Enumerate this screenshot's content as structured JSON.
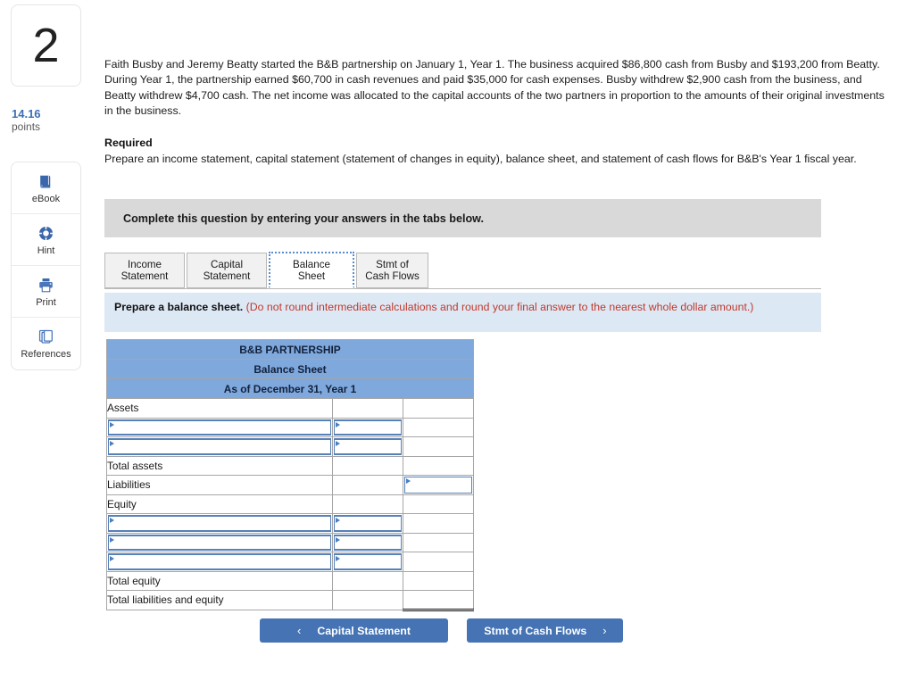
{
  "question": {
    "number": "2",
    "points_value": "14.16",
    "points_label": "points"
  },
  "tools": [
    {
      "label": "eBook",
      "icon": "book-icon"
    },
    {
      "label": "Hint",
      "icon": "lifebuoy-icon"
    },
    {
      "label": "Print",
      "icon": "printer-icon"
    },
    {
      "label": "References",
      "icon": "pages-icon"
    }
  ],
  "problem": {
    "body": "Faith Busby and Jeremy Beatty started the B&B partnership on January 1, Year 1. The business acquired $86,800 cash from Busby and $193,200 from Beatty. During Year 1, the partnership earned $60,700 in cash revenues and paid $35,000 for cash expenses. Busby withdrew $2,900 cash from the business, and Beatty withdrew $4,700 cash. The net income was allocated to the capital accounts of the two partners in proportion to the amounts of their original investments in the business.",
    "required_heading": "Required",
    "required_body": "Prepare an income statement, capital statement (statement of changes in equity), balance sheet, and statement of cash flows for B&B's Year 1 fiscal year."
  },
  "complete_bar": {
    "text": "Complete this question by entering your answers in the tabs below."
  },
  "tabs": [
    {
      "label": "Income Statement",
      "active": false
    },
    {
      "label": "Capital Statement",
      "active": false
    },
    {
      "label": "Balance Sheet",
      "active": true
    },
    {
      "label": "Stmt of Cash Flows",
      "active": false
    }
  ],
  "instruction": {
    "bold": "Prepare a balance sheet.",
    "red": "(Do not round intermediate calculations and round your final answer to the nearest whole dollar amount.)"
  },
  "balance_sheet": {
    "title_line_1": "B&B PARTNERSHIP",
    "title_line_2": "Balance Sheet",
    "title_line_3": "As of December 31, Year 1",
    "rows": [
      {
        "label": "Assets",
        "type": "label",
        "c2": "",
        "c3": ""
      },
      {
        "label": "",
        "type": "input2",
        "c2": "",
        "c3": ""
      },
      {
        "label": "",
        "type": "input2",
        "c2": "",
        "c3": ""
      },
      {
        "label": "Total assets",
        "type": "label",
        "c2": "",
        "c3": ""
      },
      {
        "label": "Liabilities",
        "type": "input3",
        "c2": "",
        "c3": ""
      },
      {
        "label": "Equity",
        "type": "label",
        "c2": "",
        "c3": ""
      },
      {
        "label": "",
        "type": "input2",
        "c2": "",
        "c3": ""
      },
      {
        "label": "",
        "type": "input2",
        "c2": "",
        "c3": ""
      },
      {
        "label": "",
        "type": "input2",
        "c2": "",
        "c3": ""
      },
      {
        "label": "Total equity",
        "type": "label",
        "c2": "",
        "c3": ""
      },
      {
        "label": "Total liabilities and equity",
        "type": "total",
        "c2": "",
        "c3": ""
      }
    ]
  },
  "nav": {
    "prev_label": "Capital Statement",
    "prev_chevron": "‹",
    "next_label": "Stmt of Cash Flows",
    "next_chevron": "›"
  },
  "colors": {
    "table_header_blue": "#7fa8dd",
    "button_blue": "#4573b3",
    "banner_blue": "#dde8f5",
    "complete_bar_gray": "#d9d9d9",
    "points_blue": "#3a6fb7",
    "red_text": "#c0392b"
  }
}
